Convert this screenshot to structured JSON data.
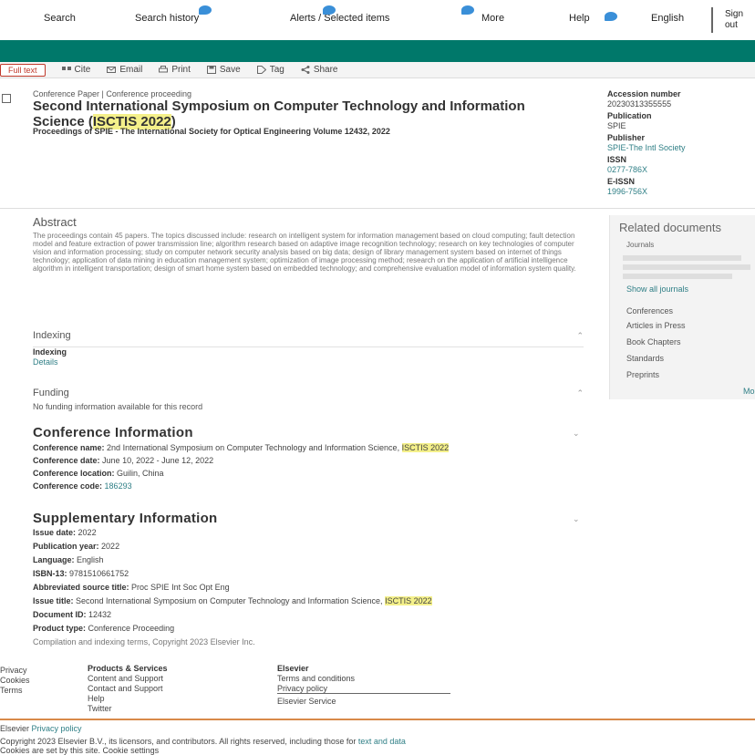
{
  "nav": {
    "items": [
      {
        "label": "Search",
        "badge": false
      },
      {
        "label": "Search history",
        "badge": true
      },
      {
        "label": "Alerts / Selected items",
        "badge": true
      },
      {
        "label": "More",
        "badge": true
      },
      {
        "label": "Help",
        "badge": true
      },
      {
        "label": "English",
        "badge": false
      }
    ],
    "user_line1": "Sign",
    "user_line2": "out"
  },
  "colors": {
    "brand_green": "#00786a",
    "link_teal": "#2f7f86",
    "highlight": "#f4f08a",
    "pdf_red": "#c0392b",
    "badge_blue": "#3a8fd8"
  },
  "toolbar": {
    "pdf_label": "Full text",
    "tools": [
      {
        "label": "Cite",
        "icon": "quote-icon"
      },
      {
        "label": "Email",
        "icon": "email-icon"
      },
      {
        "label": "Print",
        "icon": "print-icon"
      },
      {
        "label": "Save",
        "icon": "save-icon"
      },
      {
        "label": "Tag",
        "icon": "tag-icon"
      },
      {
        "label": "Share",
        "icon": "share-icon"
      }
    ]
  },
  "record": {
    "doc_type": "Conference Paper | Conference proceeding",
    "title_main": "Second International Symposium on Computer Technology and Information Science (",
    "title_highlight": "ISCTIS 2022",
    "title_end": ")",
    "source": "Proceedings of SPIE - The International Society for Optical Engineering Volume 12432, 2022"
  },
  "meta": [
    {
      "label": "Accession number",
      "value": "20230313355555",
      "type": "value"
    },
    {
      "label": "Publication",
      "value": "SPIE",
      "type": "value"
    },
    {
      "label": "Publisher",
      "value": "SPIE-The Intl Society",
      "type": "link"
    },
    {
      "label": "ISSN",
      "value": "0277-786X",
      "type": "link"
    },
    {
      "label": "E-ISSN",
      "value": "1996-756X",
      "type": "link"
    }
  ],
  "abstract": {
    "title": "Abstract",
    "text": "The proceedings contain 45 papers. The topics discussed include: research on intelligent system for information management based on cloud computing; fault detection model and feature extraction of power transmission line; algorithm research based on adaptive image recognition technology; research on key technologies of computer vision and information processing; study on computer network security analysis based on big data; design of library management system based on internet of things technology; application of data mining in education management system; optimization of image processing method; research on the application of artificial intelligence algorithm in intelligent transportation; design of smart home system based on embedded technology; and comprehensive evaluation model of information system quality."
  },
  "keywords": {
    "title": "Indexing",
    "label": "Indexing",
    "value": "Details"
  },
  "funding": {
    "title": "Funding",
    "text": "No funding information available for this record"
  },
  "conference": {
    "title": "Conference Information",
    "rows": [
      {
        "label": "Conference name:",
        "text": "2nd International Symposium on Computer Technology and Information Science,",
        "highlight": "ISCTIS 2022"
      },
      {
        "label": "Conference date:",
        "text": "June 10, 2022 - June 12, 2022",
        "highlight": ""
      },
      {
        "label": "Conference location:",
        "text": "Guilin, China",
        "highlight": ""
      },
      {
        "label": "Conference code:",
        "text": "",
        "highlight": "",
        "link": "186293"
      }
    ]
  },
  "supplementary": {
    "title": "Supplementary Information",
    "rows": [
      {
        "label": "Issue date:",
        "text": "2022",
        "highlight": ""
      },
      {
        "label": "Publication year:",
        "text": "2022",
        "highlight": ""
      },
      {
        "label": "Language:",
        "text": "English",
        "highlight": ""
      },
      {
        "label": "ISBN-13:",
        "text": "9781510661752",
        "highlight": ""
      },
      {
        "label": "Abbreviated source title:",
        "text": "Proc SPIE Int Soc Opt Eng",
        "highlight": ""
      },
      {
        "label": "Issue title:",
        "text": "Second International Symposium on Computer Technology and Information Science,",
        "highlight": "ISCTIS 2022"
      },
      {
        "label": "Document ID:",
        "text": "12432",
        "highlight": ""
      },
      {
        "label": "Product type:",
        "text": "Conference Proceeding",
        "highlight": ""
      },
      {
        "label": "",
        "text": "Compilation and indexing terms, Copyright 2023 Elsevier Inc.",
        "highlight": ""
      }
    ]
  },
  "related": {
    "title": "Related documents",
    "subtitle": "Journals",
    "show_all": "Show all journals",
    "items": [
      "Conferences",
      "Articles in Press",
      "Book Chapters",
      "Standards",
      "Preprints"
    ],
    "more": "More"
  },
  "footer": {
    "col1": [
      "Privacy",
      "Cookies",
      "Terms"
    ],
    "col2_head": "Products & Services",
    "col2": [
      "Content and Support",
      "Contact and Support",
      "Help",
      "Twitter"
    ],
    "col3_head": "Elsevier",
    "col3": [
      "Terms and conditions",
      "Privacy policy"
    ],
    "col3_bottom": "Elsevier Service",
    "bottom1_a": "Elsevier ",
    "bottom1_b": "Privacy policy",
    "bottom2_a": "Copyright 2023 Elsevier B.V., its licensors, and contributors. All rights reserved, including those for ",
    "bottom2_link": "text and data",
    "bottom3": "Cookies are set by this site. Cookie settings"
  }
}
